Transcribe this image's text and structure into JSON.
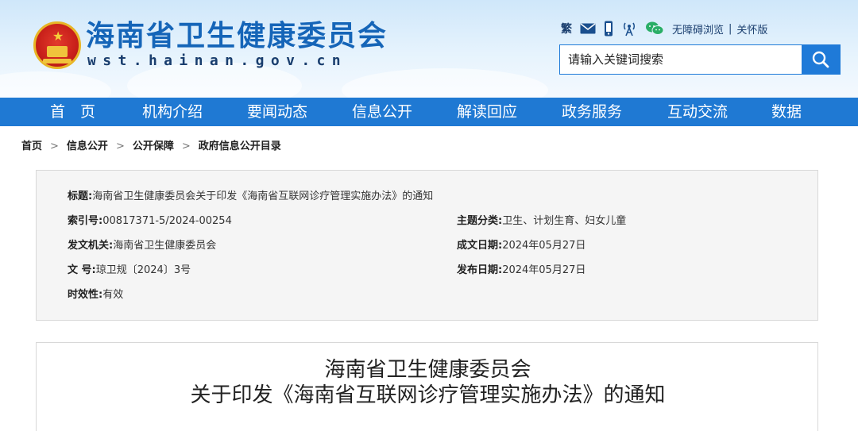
{
  "header": {
    "site_title": "海南省卫生健康委员会",
    "site_domain": "wst.hainan.gov.cn",
    "tools": {
      "traditional": "繁",
      "accessible_label": "无障碍浏览",
      "separator": "|",
      "care_label": "关怀版"
    },
    "search": {
      "placeholder": "请输入关键词搜索"
    }
  },
  "nav": {
    "items": [
      {
        "label": "首　页"
      },
      {
        "label": "机构介绍"
      },
      {
        "label": "要闻动态"
      },
      {
        "label": "信息公开"
      },
      {
        "label": "解读回应"
      },
      {
        "label": "政务服务"
      },
      {
        "label": "互动交流"
      },
      {
        "label": "数据"
      }
    ]
  },
  "breadcrumb": {
    "items": [
      "首页",
      "信息公开",
      "公开保障",
      "政府信息公开目录"
    ],
    "separator": ">"
  },
  "info": {
    "title_label": "标题:",
    "title_value": "海南省卫生健康委员会关于印发《海南省互联网诊疗管理实施办法》的通知",
    "index_label": "索引号:",
    "index_value": "00817371-5/2024-00254",
    "topic_label": "主题分类:",
    "topic_value": "卫生、计划生育、妇女儿童",
    "issuer_label": "发文机关:",
    "issuer_value": "海南省卫生健康委员会",
    "written_label": "成文日期:",
    "written_value": "2024年05月27日",
    "docno_label": "文 号:",
    "docno_value": "琼卫规〔2024〕3号",
    "published_label": "发布日期:",
    "published_value": "2024年05月27日",
    "validity_label": "时效性:",
    "validity_value": "有效"
  },
  "article": {
    "title_line1": "海南省卫生健康委员会",
    "title_line2": "关于印发《海南省互联网诊疗管理实施办法》的通知"
  },
  "colors": {
    "brand_blue": "#1f79d3",
    "title_blue": "#1565b8",
    "emblem_red": "#c8201a",
    "wechat_green": "#2aae67"
  }
}
